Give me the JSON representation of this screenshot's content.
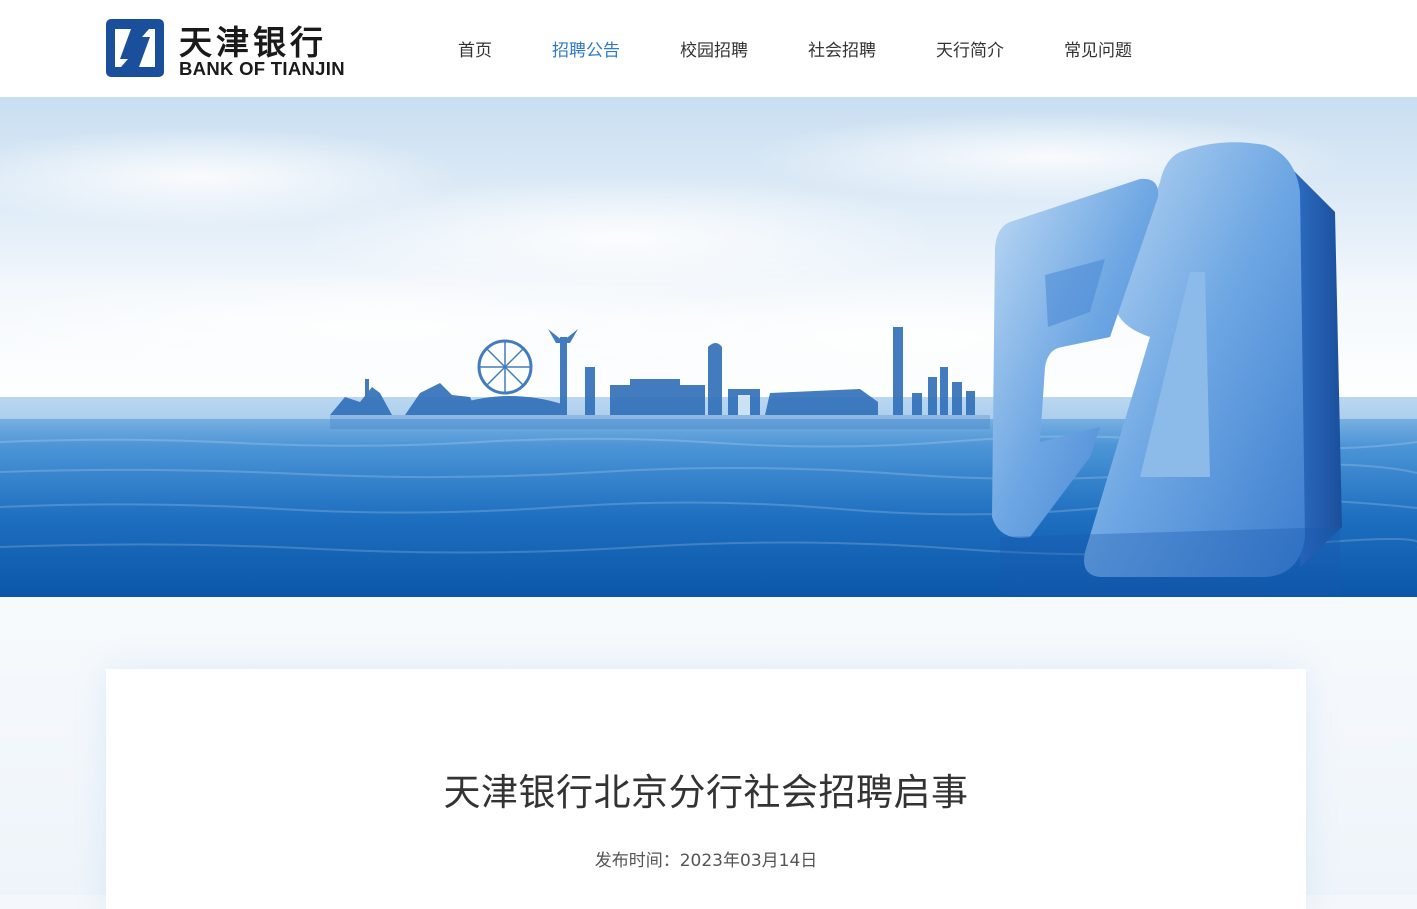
{
  "brand": {
    "name_cn": "天津银行",
    "name_en": "BANK OF TIANJIN",
    "color": "#1a4f9c"
  },
  "nav": {
    "items": [
      {
        "label": "首页",
        "active": false
      },
      {
        "label": "招聘公告",
        "active": true
      },
      {
        "label": "校园招聘",
        "active": false
      },
      {
        "label": "社会招聘",
        "active": false
      },
      {
        "label": "天行简介",
        "active": false
      },
      {
        "label": "常见问题",
        "active": false
      }
    ],
    "active_color": "#2f7bc4"
  },
  "article": {
    "title": "天津银行北京分行社会招聘启事",
    "meta_label": "发布时间：",
    "publish_date": "2023年03月14日"
  }
}
